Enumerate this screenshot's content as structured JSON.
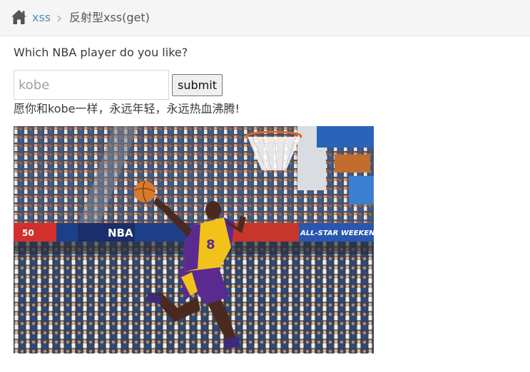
{
  "breadcrumb": {
    "home_icon": "home-icon",
    "link_label": "xss",
    "separator_icon": "chevron-right-icon",
    "current_label": "反射型xss(get)"
  },
  "form": {
    "question": "Which NBA player do you like?",
    "input_value": "",
    "input_placeholder": "kobe",
    "submit_label": "submit"
  },
  "result": {
    "message": "愿你和kobe一样，永远年轻，永远热血沸腾!"
  },
  "photo": {
    "banner_left": "NBA",
    "banner_right": "ALL-STAR WEEKEND",
    "jersey_number": "8",
    "banner_small": "50"
  },
  "colors": {
    "link": "#4c8fbd",
    "header_bg": "#f5f5f5",
    "text": "#393939"
  }
}
